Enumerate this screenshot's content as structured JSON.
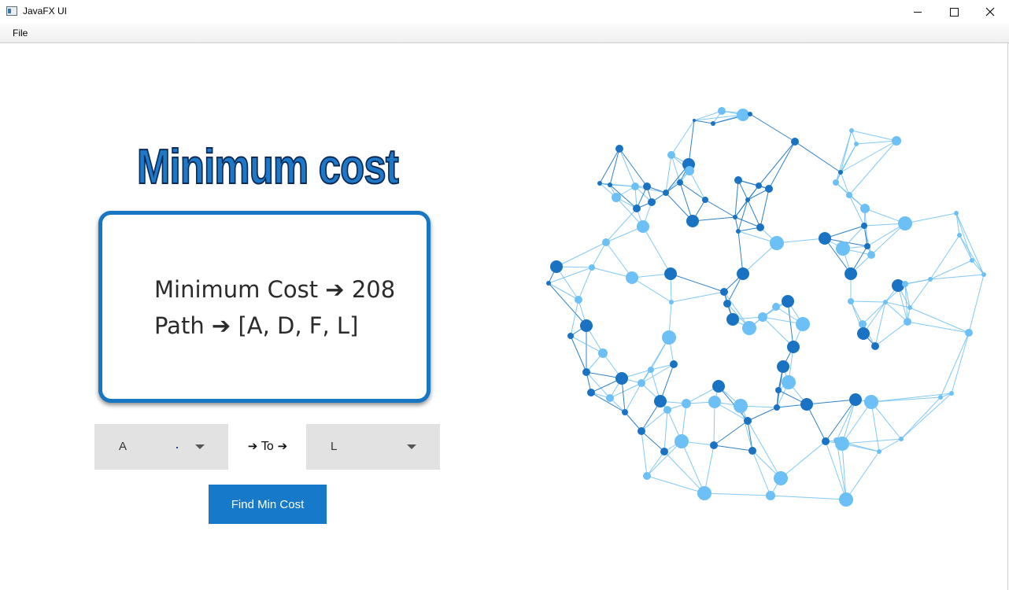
{
  "window": {
    "title": "JavaFX UI",
    "controls": {
      "minimize_icon": "minimize-icon",
      "maximize_icon": "maximize-icon",
      "close_icon": "close-icon"
    }
  },
  "menubar": {
    "items": [
      "File"
    ]
  },
  "main": {
    "heading": "Minimum cost",
    "result": {
      "cost_line": "Minimum Cost ➔ 208",
      "path_line": "Path ➔ [A, D, F, L]"
    },
    "from_select": {
      "value": "A"
    },
    "to_label": "➔ To ➔",
    "to_select": {
      "value": "L"
    },
    "find_button": "Find Min Cost"
  },
  "colors": {
    "accent": "#1779c9",
    "heading": "#1e78c8",
    "network_dark": "#1a73c2",
    "network_light": "#6cc0f5",
    "combo_bg": "#e2e2e2"
  },
  "decor": {
    "network_image": "network-graph-illustration"
  }
}
